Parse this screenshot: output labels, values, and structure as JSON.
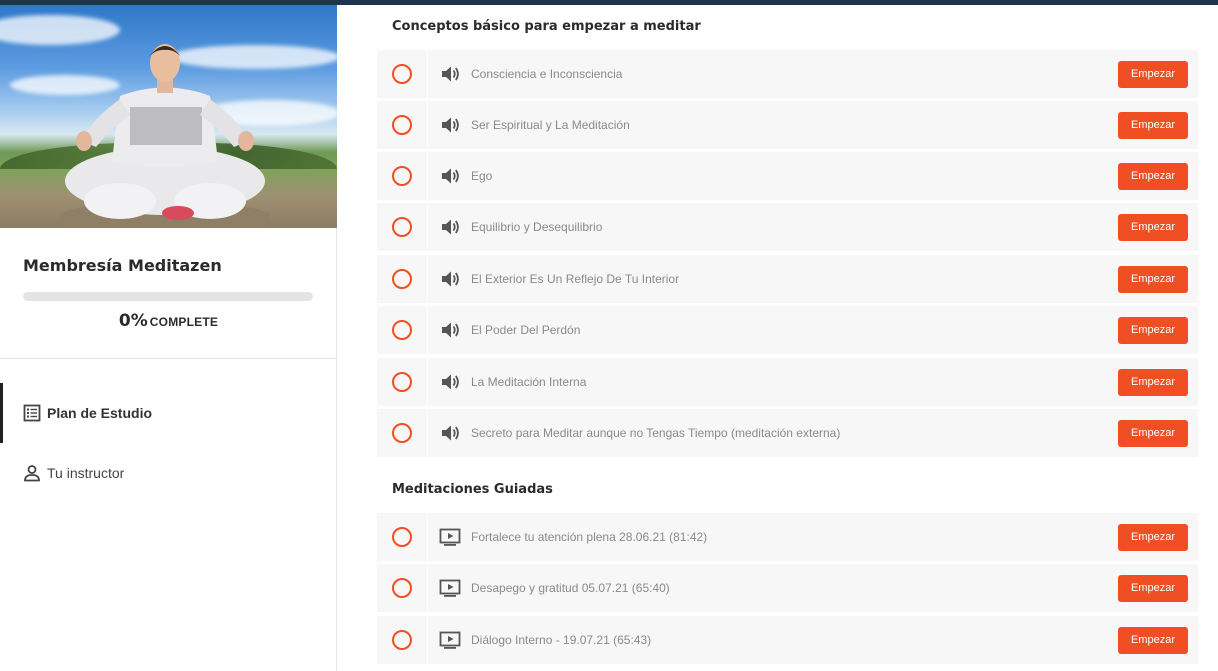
{
  "sidebar": {
    "course_title": "Membresía Meditazen",
    "progress": {
      "percent_value": 0,
      "percent_text": "0%",
      "label": "COMPLETE"
    },
    "nav": [
      {
        "label": "Plan de Estudio",
        "icon": "list-icon",
        "active": true
      },
      {
        "label": "Tu instructor",
        "icon": "person-icon",
        "active": false
      }
    ]
  },
  "sections": [
    {
      "title": "Conceptos básico para empezar a meditar",
      "lessons": [
        {
          "title": "Consciencia e Inconsciencia",
          "type_icon": "audio-icon",
          "button": "Empezar"
        },
        {
          "title": "Ser Espiritual y La Meditación",
          "type_icon": "audio-icon",
          "button": "Empezar"
        },
        {
          "title": "Ego",
          "type_icon": "audio-icon",
          "button": "Empezar"
        },
        {
          "title": "Equilibrio y Desequilibrio",
          "type_icon": "audio-icon",
          "button": "Empezar"
        },
        {
          "title": "El Exterior Es Un Reflejo De Tu Interior",
          "type_icon": "audio-icon",
          "button": "Empezar"
        },
        {
          "title": "El Poder Del Perdón",
          "type_icon": "audio-icon",
          "button": "Empezar"
        },
        {
          "title": "La Meditación Interna",
          "type_icon": "audio-icon",
          "button": "Empezar"
        },
        {
          "title": "Secreto para Meditar aunque no Tengas Tiempo (meditación externa)",
          "type_icon": "audio-icon",
          "button": "Empezar"
        }
      ]
    },
    {
      "title": "Meditaciones Guiadas",
      "lessons": [
        {
          "title": "Fortalece tu atención plena 28.06.21 (81:42)",
          "type_icon": "video-icon",
          "button": "Empezar"
        },
        {
          "title": "Desapego y gratitud 05.07.21 (65:40)",
          "type_icon": "video-icon",
          "button": "Empezar"
        },
        {
          "title": "Diálogo Interno - 19.07.21 (65:43)",
          "type_icon": "video-icon",
          "button": "Empezar"
        }
      ]
    }
  ],
  "colors": {
    "accent": "#f04e23",
    "top_bar": "#1e3550",
    "row_bg": "#f7f7f7"
  }
}
